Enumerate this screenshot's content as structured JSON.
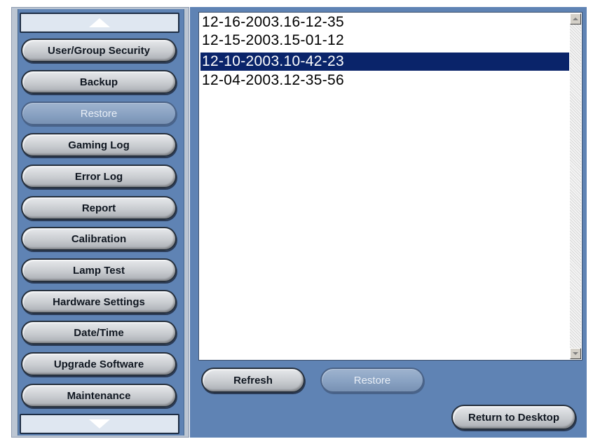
{
  "sidebar": {
    "scroll_up_icon": "triangle-up-icon",
    "scroll_down_icon": "triangle-down-icon",
    "items": [
      {
        "label": "User/Group Security",
        "enabled": true
      },
      {
        "label": "Backup",
        "enabled": true
      },
      {
        "label": "Restore",
        "enabled": false
      },
      {
        "label": "Gaming Log",
        "enabled": true
      },
      {
        "label": "Error Log",
        "enabled": true
      },
      {
        "label": "Report",
        "enabled": true
      },
      {
        "label": "Calibration",
        "enabled": true
      },
      {
        "label": "Lamp Test",
        "enabled": true
      },
      {
        "label": "Hardware Settings",
        "enabled": true
      },
      {
        "label": "Date/Time",
        "enabled": true
      },
      {
        "label": "Upgrade Software",
        "enabled": true
      },
      {
        "label": "Maintenance",
        "enabled": true
      }
    ]
  },
  "backup_list": {
    "items": [
      "12-16-2003.16-12-35",
      "12-15-2003.15-01-12",
      "12-10-2003.10-42-23",
      "12-04-2003.12-35-56"
    ],
    "selected_item": "12-10-2003.10-42-23"
  },
  "actions": {
    "refresh_label": "Refresh",
    "restore_label": "Restore",
    "return_label": "Return to Desktop"
  },
  "colors": {
    "panel_blue": "#5f83b4",
    "selection_navy": "#0a246a"
  }
}
